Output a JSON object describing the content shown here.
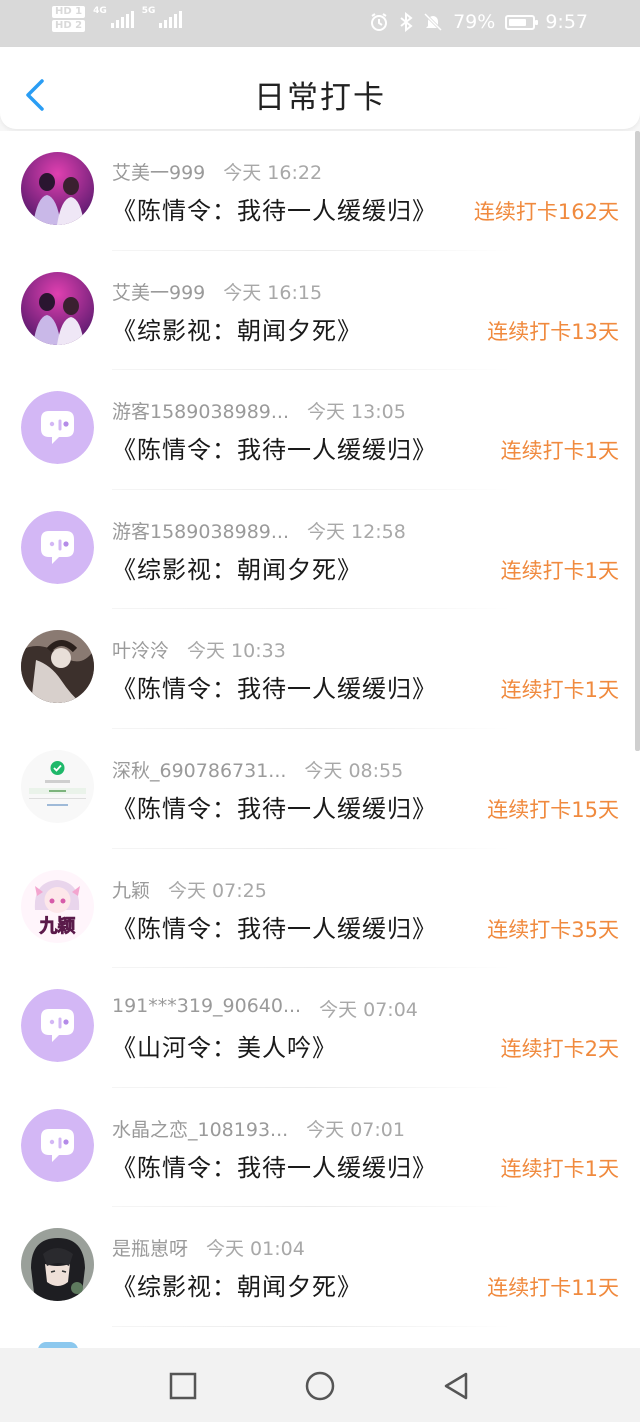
{
  "status_bar": {
    "hd1": "HD 1",
    "hd2": "HD 2",
    "net1": "4G",
    "net2": "5G",
    "battery_pct": "79%",
    "battery_level": 0.79,
    "time": "9:57"
  },
  "header": {
    "title": "日常打卡",
    "back_icon": "back-chevron-icon"
  },
  "items": [
    {
      "user": "艾美一999",
      "time": "今天 16:22",
      "work": "《陈情令：我待一人缓缓归》",
      "streak": "连续打卡162天",
      "avatar": "photo-purple"
    },
    {
      "user": "艾美一999",
      "time": "今天 16:15",
      "work": "《综影视：朝闻夕死》",
      "streak": "连续打卡13天",
      "avatar": "photo-purple"
    },
    {
      "user": "游客1589038989...",
      "time": "今天 13:05",
      "work": "《陈情令：我待一人缓缓归》",
      "streak": "连续打卡1天",
      "avatar": "default-chat"
    },
    {
      "user": "游客1589038989...",
      "time": "今天 12:58",
      "work": "《综影视：朝闻夕死》",
      "streak": "连续打卡1天",
      "avatar": "default-chat"
    },
    {
      "user": "叶泠泠",
      "time": "今天 10:33",
      "work": "《陈情令：我待一人缓缓归》",
      "streak": "连续打卡1天",
      "avatar": "photo-dark"
    },
    {
      "user": "深秋_690786731...",
      "time": "今天 08:55",
      "work": "《陈情令：我待一人缓缓归》",
      "streak": "连续打卡15天",
      "avatar": "screenshot-green"
    },
    {
      "user": "九颖",
      "time": "今天 07:25",
      "work": "《陈情令：我待一人缓缓归》",
      "streak": "连续打卡35天",
      "avatar": "anime-pink",
      "avatar_text": "九颖"
    },
    {
      "user": "191***319_90640...",
      "time": "今天 07:04",
      "work": "《山河令：美人吟》",
      "streak": "连续打卡2天",
      "avatar": "default-chat"
    },
    {
      "user": "水晶之恋_108193...",
      "time": "今天 07:01",
      "work": "《陈情令：我待一人缓缓归》",
      "streak": "连续打卡1天",
      "avatar": "default-chat"
    },
    {
      "user": "是瓶崽呀",
      "time": "今天 01:04",
      "work": "《综影视：朝闻夕死》",
      "streak": "连续打卡11天",
      "avatar": "anime-dark"
    }
  ],
  "nav_bar": {
    "recent": "square-icon",
    "home": "circle-icon",
    "back": "triangle-back-icon"
  },
  "colors": {
    "accent": "#2a9df4",
    "streak": "#f08a3e",
    "default_avatar": "#d3b7f5"
  }
}
